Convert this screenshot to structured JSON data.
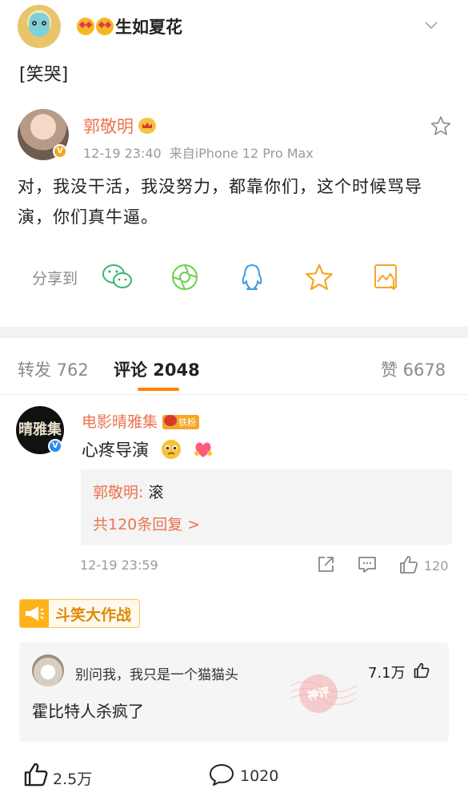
{
  "post": {
    "username": "生如夏花",
    "text": "[笑哭]"
  },
  "original": {
    "author": "郭敬明",
    "time": "12-19 23:40",
    "source": "来自iPhone 12 Pro Max",
    "body": "对，我没干活，我没努力，都靠你们，这个时候骂导演，你们真牛逼。"
  },
  "share": {
    "label": "分享到",
    "targets": [
      "wechat-icon",
      "moments-icon",
      "qq-icon",
      "favorite-icon",
      "save-image-icon"
    ]
  },
  "tabs": {
    "repost": "转发 762",
    "comment": "评论 2048",
    "like": "赞 6678"
  },
  "comment": {
    "author": "电影晴雅集",
    "avatar_text": "晴雅集",
    "badge": "铁粉",
    "text": "心疼导演",
    "reply_author": "郭敬明:",
    "reply_text": "滚",
    "reply_more": "共120条回复 >",
    "time": "12-19 23:59",
    "likes": "120"
  },
  "activity": {
    "label": "斗笑大作战"
  },
  "featured": {
    "author": "别问我，我只是一个猫猫头",
    "likes": "7.1万",
    "text": "霍比特人杀疯了",
    "stamp": "神评"
  },
  "footer": {
    "likes": "2.5万",
    "comments": "1020"
  },
  "colors": {
    "accent": "#ff8200",
    "name": "#eb7350",
    "meta": "#9a9a9a"
  }
}
